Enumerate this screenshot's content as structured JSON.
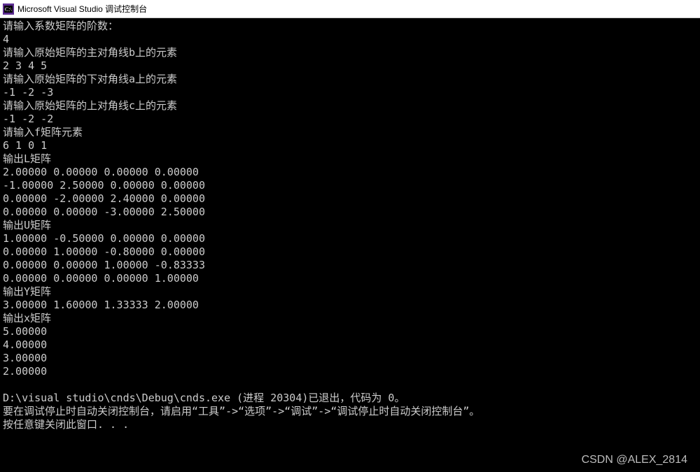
{
  "window": {
    "title": "Microsoft Visual Studio 调试控制台"
  },
  "lines": [
    "请输入系数矩阵的阶数：",
    "4",
    "请输入原始矩阵的主对角线b上的元素",
    "2 3 4 5",
    "请输入原始矩阵的下对角线a上的元素",
    "-1 -2 -3",
    "请输入原始矩阵的上对角线c上的元素",
    "-1 -2 -2",
    "请输入f矩阵元素",
    "6 1 0 1",
    "输出L矩阵",
    "2.00000 0.00000 0.00000 0.00000",
    "-1.00000 2.50000 0.00000 0.00000",
    "0.00000 -2.00000 2.40000 0.00000",
    "0.00000 0.00000 -3.00000 2.50000",
    "输出U矩阵",
    "1.00000 -0.50000 0.00000 0.00000",
    "0.00000 1.00000 -0.80000 0.00000",
    "0.00000 0.00000 1.00000 -0.83333",
    "0.00000 0.00000 0.00000 1.00000",
    "输出Y矩阵",
    "3.00000 1.60000 1.33333 2.00000",
    "输出x矩阵",
    "5.00000",
    "4.00000",
    "3.00000",
    "2.00000",
    "",
    "D:\\visual studio\\cnds\\Debug\\cnds.exe (进程 20304)已退出，代码为 0。",
    "要在调试停止时自动关闭控制台，请启用“工具”->“选项”->“调试”->“调试停止时自动关闭控制台”。",
    "按任意键关闭此窗口. . ."
  ],
  "watermark": "CSDN @ALEX_2814"
}
